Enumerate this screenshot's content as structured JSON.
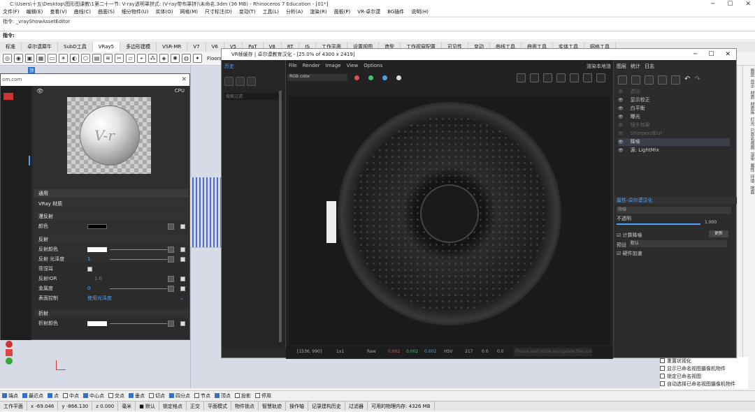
{
  "app": {
    "title": "C:\\Users\\十五\\Desktop\\图形图课教\\1第二十一节: V-ray透明罩拼式: (V-ray带布罩拼)\\未命名.3dm (36 MB) - Rhinoceros 7 Education - [01*]",
    "menu": [
      "文件(F)",
      "编辑(E)",
      "查看(V)",
      "曲线(C)",
      "曲面(S)",
      "细分物件(U)",
      "实体(O)",
      "网格(M)",
      "尺寸标注(D)",
      "变动(T)",
      "工具(L)",
      "分析(A)",
      "渲染(R)",
      "面板(P)",
      "VR-卓尔谟",
      "BG插件",
      "说明(H)"
    ],
    "command_history": "指令: _vrayShowAssetEditor",
    "command_prompt": "指令:",
    "tabs": [
      "标准",
      "卓尔谟犀牛",
      "SubD工具",
      "VRay5",
      "多边形建模",
      "VSR-MR",
      "V7",
      "V6",
      "V5",
      "PaT",
      "V8",
      "RT",
      "JS",
      "工作平面",
      "设置视图",
      "造型",
      "工作视窗配置",
      "可见性",
      "变动",
      "曲线工具",
      "曲面工具",
      "实体工具",
      "网格工具"
    ],
    "active_tab": "VRay5",
    "toolbar_floors": "Floors"
  },
  "viewport_label": "顶",
  "material_editor": {
    "url": "om.com",
    "cpu_label": "CPU",
    "header_general": "通用",
    "material_name": "VRay 材质",
    "sections": {
      "diffuse": "漫反射",
      "reflection": "反射",
      "refraction": "折射"
    },
    "rows": {
      "diffuse_color": "颜色",
      "refl_color": "反射颜色",
      "refl_gloss": "反射 光泽度",
      "refl_gloss_val": "1",
      "fresnel": "菲涅耳",
      "refl_ior": "反射IOR",
      "refl_ior_val": "1.6",
      "metalness": "金属度",
      "metalness_val": "0",
      "brdf": "表面控制",
      "brdf_val": "使用光泽度",
      "refr_color": "折射颜色"
    }
  },
  "vfb": {
    "title": "VR帧缓存 | 卓尔谟教育汉化 - [25.0% of 4300 x 2419]",
    "history_label": "历史",
    "history_search": "搜索过滤",
    "menu": [
      "File",
      "Render",
      "Image",
      "View",
      "Options"
    ],
    "channel": "RGB color",
    "render_label": "渲染本地渲",
    "colors": {
      "red": "#e05050",
      "green": "#3fc46a",
      "blue": "#4aa3e8"
    },
    "status": {
      "coords": "[1536, 990]",
      "mode": "1x1",
      "raw": "Raw",
      "r": "0.002",
      "g": "0.002",
      "b": "0.002",
      "fmt": "HSV",
      "h": "217",
      "s": "0.0",
      "v": "0.0",
      "cmd": "Please wait while we update the scene..."
    },
    "panel": {
      "tab_layers": "图层",
      "tab_stats": "统计",
      "tab_log": "日志",
      "layers": [
        {
          "name": "选出",
          "dim": true
        },
        {
          "name": "显示校正",
          "dim": false
        },
        {
          "name": "白平衡",
          "dim": false
        },
        {
          "name": "曝光",
          "dim": false
        },
        {
          "name": "镜头效果",
          "dim": true
        },
        {
          "name": "Sharpen/Blur",
          "dim": true
        },
        {
          "name": "降噪",
          "dim": false
        },
        {
          "name": "源: LightMix",
          "dim": false
        }
      ],
      "props_title": "属性-卓尔谟汉化",
      "denoise": "降噪",
      "opacity": "不透明",
      "opacity_val": "1.000",
      "compute": "计算降噪",
      "update": "更新",
      "preset_label": "预设",
      "preset_val": "默认",
      "fast": "硬件加速"
    }
  },
  "named_views": [
    "重置状视化",
    "显示已命名视图摄像机物件",
    "锁定已命名视图",
    "自动选择已命名视图摄像机物件"
  ],
  "right_strip": [
    "图层",
    "显示",
    "材质",
    "材质库",
    "灯光",
    "已命名视图",
    "渲染",
    "属性",
    "环境",
    "地面"
  ],
  "snaps": [
    {
      "label": "端点",
      "on": true
    },
    {
      "label": "最近点",
      "on": true
    },
    {
      "label": "点",
      "on": true
    },
    {
      "label": "中点",
      "on": false
    },
    {
      "label": "中心点",
      "on": true
    },
    {
      "label": "交点",
      "on": false
    },
    {
      "label": "垂点",
      "on": true
    },
    {
      "label": "切点",
      "on": false
    },
    {
      "label": "四分点",
      "on": true
    },
    {
      "label": "节点",
      "on": false
    },
    {
      "label": "顶点",
      "on": true
    },
    {
      "label": "投影",
      "on": false
    },
    {
      "label": "停用",
      "on": false
    }
  ],
  "status": {
    "cplane": "工作平面",
    "x": "x -69.046",
    "y": "y -866.130",
    "z": "z 0.000",
    "unit": "毫米",
    "layer": "默认",
    "buttons": [
      "锁定格点",
      "正交",
      "平面模式",
      "物件锁点",
      "智慧轨迹",
      "操作轴",
      "记录建构历史",
      "过滤器"
    ],
    "memory": "可用的物理内存: 4326 MB"
  }
}
